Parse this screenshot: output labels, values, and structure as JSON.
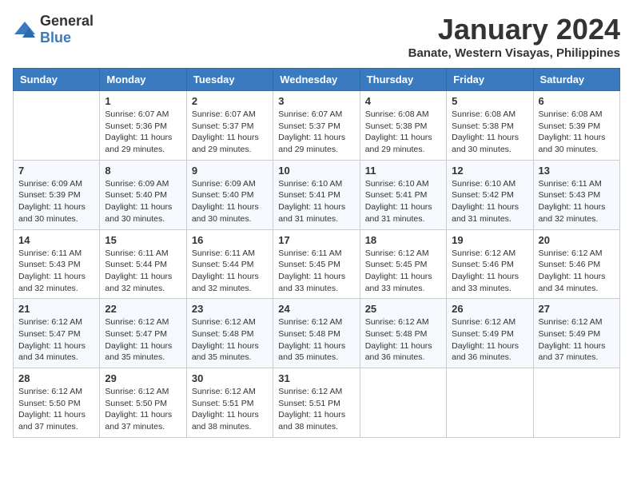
{
  "logo": {
    "general": "General",
    "blue": "Blue"
  },
  "header": {
    "title": "January 2024",
    "subtitle": "Banate, Western Visayas, Philippines"
  },
  "weekdays": [
    "Sunday",
    "Monday",
    "Tuesday",
    "Wednesday",
    "Thursday",
    "Friday",
    "Saturday"
  ],
  "weeks": [
    [
      {
        "day": null,
        "info": null
      },
      {
        "day": "1",
        "info": "Sunrise: 6:07 AM\nSunset: 5:36 PM\nDaylight: 11 hours\nand 29 minutes."
      },
      {
        "day": "2",
        "info": "Sunrise: 6:07 AM\nSunset: 5:37 PM\nDaylight: 11 hours\nand 29 minutes."
      },
      {
        "day": "3",
        "info": "Sunrise: 6:07 AM\nSunset: 5:37 PM\nDaylight: 11 hours\nand 29 minutes."
      },
      {
        "day": "4",
        "info": "Sunrise: 6:08 AM\nSunset: 5:38 PM\nDaylight: 11 hours\nand 29 minutes."
      },
      {
        "day": "5",
        "info": "Sunrise: 6:08 AM\nSunset: 5:38 PM\nDaylight: 11 hours\nand 30 minutes."
      },
      {
        "day": "6",
        "info": "Sunrise: 6:08 AM\nSunset: 5:39 PM\nDaylight: 11 hours\nand 30 minutes."
      }
    ],
    [
      {
        "day": "7",
        "info": "Sunrise: 6:09 AM\nSunset: 5:39 PM\nDaylight: 11 hours\nand 30 minutes."
      },
      {
        "day": "8",
        "info": "Sunrise: 6:09 AM\nSunset: 5:40 PM\nDaylight: 11 hours\nand 30 minutes."
      },
      {
        "day": "9",
        "info": "Sunrise: 6:09 AM\nSunset: 5:40 PM\nDaylight: 11 hours\nand 30 minutes."
      },
      {
        "day": "10",
        "info": "Sunrise: 6:10 AM\nSunset: 5:41 PM\nDaylight: 11 hours\nand 31 minutes."
      },
      {
        "day": "11",
        "info": "Sunrise: 6:10 AM\nSunset: 5:41 PM\nDaylight: 11 hours\nand 31 minutes."
      },
      {
        "day": "12",
        "info": "Sunrise: 6:10 AM\nSunset: 5:42 PM\nDaylight: 11 hours\nand 31 minutes."
      },
      {
        "day": "13",
        "info": "Sunrise: 6:11 AM\nSunset: 5:43 PM\nDaylight: 11 hours\nand 32 minutes."
      }
    ],
    [
      {
        "day": "14",
        "info": "Sunrise: 6:11 AM\nSunset: 5:43 PM\nDaylight: 11 hours\nand 32 minutes."
      },
      {
        "day": "15",
        "info": "Sunrise: 6:11 AM\nSunset: 5:44 PM\nDaylight: 11 hours\nand 32 minutes."
      },
      {
        "day": "16",
        "info": "Sunrise: 6:11 AM\nSunset: 5:44 PM\nDaylight: 11 hours\nand 32 minutes."
      },
      {
        "day": "17",
        "info": "Sunrise: 6:11 AM\nSunset: 5:45 PM\nDaylight: 11 hours\nand 33 minutes."
      },
      {
        "day": "18",
        "info": "Sunrise: 6:12 AM\nSunset: 5:45 PM\nDaylight: 11 hours\nand 33 minutes."
      },
      {
        "day": "19",
        "info": "Sunrise: 6:12 AM\nSunset: 5:46 PM\nDaylight: 11 hours\nand 33 minutes."
      },
      {
        "day": "20",
        "info": "Sunrise: 6:12 AM\nSunset: 5:46 PM\nDaylight: 11 hours\nand 34 minutes."
      }
    ],
    [
      {
        "day": "21",
        "info": "Sunrise: 6:12 AM\nSunset: 5:47 PM\nDaylight: 11 hours\nand 34 minutes."
      },
      {
        "day": "22",
        "info": "Sunrise: 6:12 AM\nSunset: 5:47 PM\nDaylight: 11 hours\nand 35 minutes."
      },
      {
        "day": "23",
        "info": "Sunrise: 6:12 AM\nSunset: 5:48 PM\nDaylight: 11 hours\nand 35 minutes."
      },
      {
        "day": "24",
        "info": "Sunrise: 6:12 AM\nSunset: 5:48 PM\nDaylight: 11 hours\nand 35 minutes."
      },
      {
        "day": "25",
        "info": "Sunrise: 6:12 AM\nSunset: 5:48 PM\nDaylight: 11 hours\nand 36 minutes."
      },
      {
        "day": "26",
        "info": "Sunrise: 6:12 AM\nSunset: 5:49 PM\nDaylight: 11 hours\nand 36 minutes."
      },
      {
        "day": "27",
        "info": "Sunrise: 6:12 AM\nSunset: 5:49 PM\nDaylight: 11 hours\nand 37 minutes."
      }
    ],
    [
      {
        "day": "28",
        "info": "Sunrise: 6:12 AM\nSunset: 5:50 PM\nDaylight: 11 hours\nand 37 minutes."
      },
      {
        "day": "29",
        "info": "Sunrise: 6:12 AM\nSunset: 5:50 PM\nDaylight: 11 hours\nand 37 minutes."
      },
      {
        "day": "30",
        "info": "Sunrise: 6:12 AM\nSunset: 5:51 PM\nDaylight: 11 hours\nand 38 minutes."
      },
      {
        "day": "31",
        "info": "Sunrise: 6:12 AM\nSunset: 5:51 PM\nDaylight: 11 hours\nand 38 minutes."
      },
      {
        "day": null,
        "info": null
      },
      {
        "day": null,
        "info": null
      },
      {
        "day": null,
        "info": null
      }
    ]
  ]
}
